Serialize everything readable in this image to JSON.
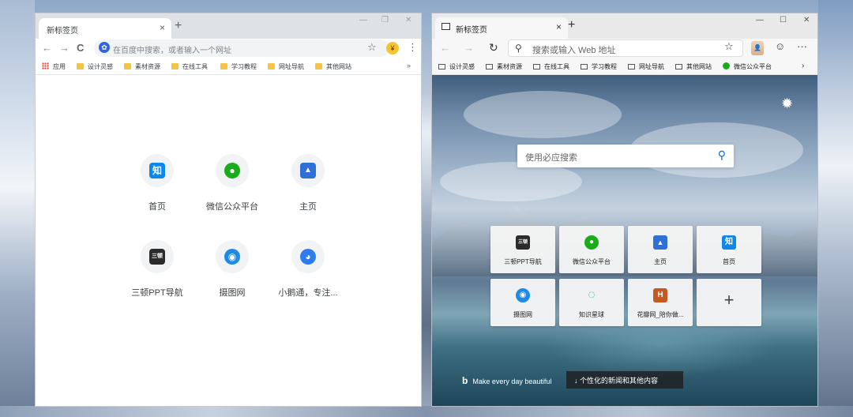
{
  "chrome": {
    "tab_title": "新标签页",
    "tab_close": "×",
    "new_tab": "+",
    "win_min": "—",
    "win_max": "❐",
    "win_close": "✕",
    "nav_back": "←",
    "nav_forward": "→",
    "nav_reload": "C",
    "omnibox_icon": "✿",
    "omnibox_placeholder": "在百度中搜索，或者输入一个网址",
    "star": "☆",
    "extension": "¥",
    "menu": "⋮",
    "bookmarks": [
      "应用",
      "设计灵感",
      "素材资源",
      "在线工具",
      "学习教程",
      "网址导航",
      "其他网站"
    ],
    "bookmarks_more": "»",
    "tiles": [
      {
        "label": "首页",
        "icon": "知",
        "color": "#0f88eb"
      },
      {
        "label": "微信公众平台",
        "icon": "●",
        "color": "#1aad19"
      },
      {
        "label": "主页",
        "icon": "▲",
        "color": "#2f6fd6"
      },
      {
        "label": "三顿PPT导航",
        "icon": "三顿",
        "color": "#2b2b2b"
      },
      {
        "label": "摄图网",
        "icon": "◉",
        "color": "#1e8ae6"
      },
      {
        "label": "小鹅通，专注...",
        "icon": "◕",
        "color": "#2f7bf0"
      }
    ]
  },
  "edge": {
    "tab_title": "新标签页",
    "tab_close": "×",
    "new_tab": "+",
    "win_min": "—",
    "win_max": "☐",
    "win_close": "✕",
    "nav_back": "←",
    "nav_forward": "→",
    "nav_refresh": "↻",
    "omnibox_icon": "⚲",
    "omnibox_placeholder": "搜索或输入 Web 地址",
    "star": "☆",
    "avatar": "👤",
    "emoji": "☺",
    "more": "···",
    "bookmarks": [
      "设计灵感",
      "素材资源",
      "在线工具",
      "学习教程",
      "网址导航",
      "其他网站",
      "微信公众平台"
    ],
    "bookmarks_more": "›",
    "settings_icon": "✹",
    "search_placeholder": "使用必应搜索",
    "search_icon": "⚲",
    "quick_links": [
      {
        "label": "三顿PPT导航",
        "icon": "三顿",
        "color": "#2b2b2b"
      },
      {
        "label": "微信公众平台",
        "icon": "●",
        "color": "#1aad19"
      },
      {
        "label": "主页",
        "icon": "▲",
        "color": "#2f6fd6"
      },
      {
        "label": "首页",
        "icon": "知",
        "color": "#0f88eb"
      },
      {
        "label": "摄图网",
        "icon": "◉",
        "color": "#1e8ae6"
      },
      {
        "label": "知识星球",
        "icon": "◌",
        "color": "#2bc07a"
      },
      {
        "label": "花瓣网_陪你做...",
        "icon": "H",
        "color": "#c45a22"
      }
    ],
    "add_tile": "+",
    "bing_logo": "b",
    "bing_slogan": "Make every day beautiful",
    "news_button": "↓  个性化的新闻和其他内容"
  }
}
